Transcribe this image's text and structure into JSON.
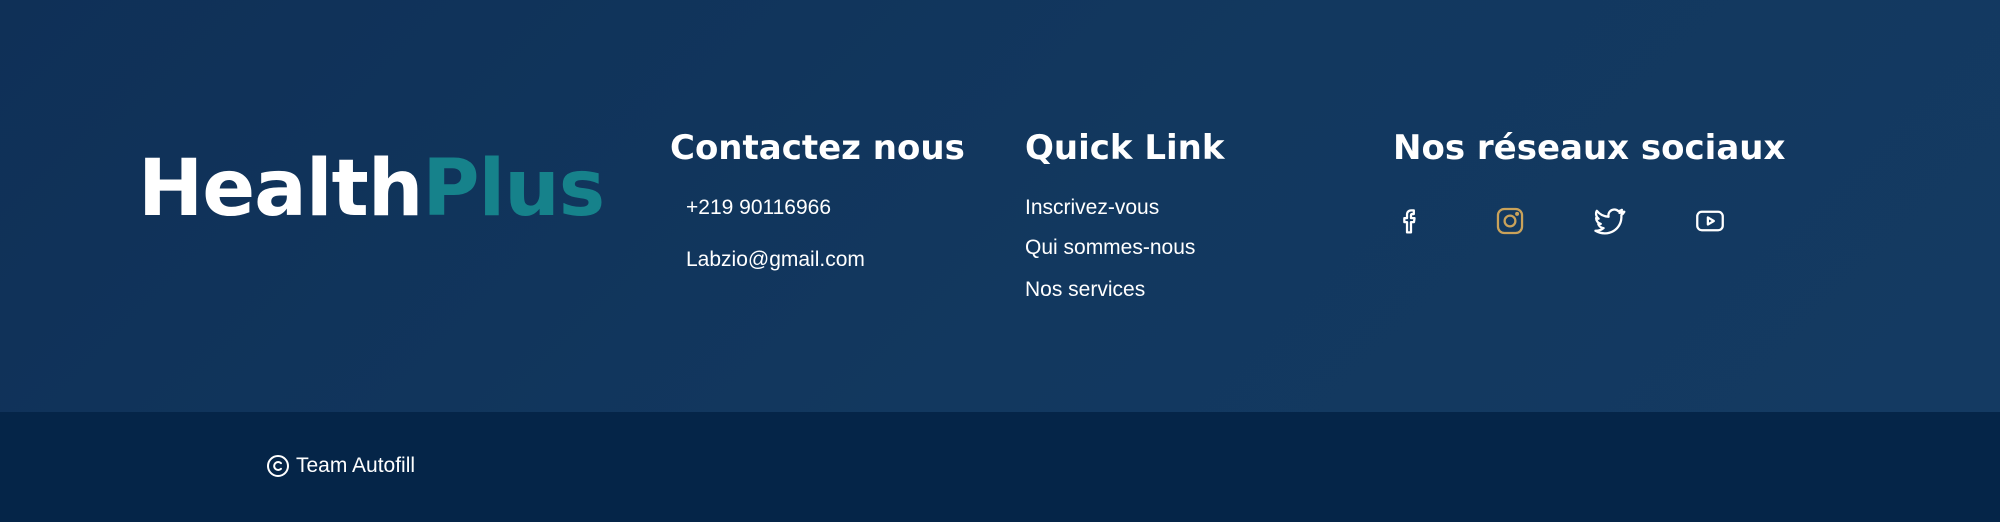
{
  "brand": {
    "part1": "Health",
    "part2": "Plus",
    "colors": {
      "primary": "#ffffff",
      "accent": "#16828b"
    }
  },
  "contact": {
    "title": "Contactez nous",
    "phone": "+219 90116966",
    "email": "Labzio@gmail.com"
  },
  "quick_links": {
    "title": "Quick Link",
    "items": [
      {
        "label": "Inscrivez-vous"
      },
      {
        "label": "Qui sommes-nous"
      },
      {
        "label": "Nos services"
      }
    ]
  },
  "social": {
    "title": "Nos réseaux sociaux",
    "icons": [
      {
        "name": "facebook-icon",
        "color": "#ffffff"
      },
      {
        "name": "instagram-icon",
        "color": "#c9a25a"
      },
      {
        "name": "twitter-icon",
        "color": "#ffffff"
      },
      {
        "name": "youtube-icon",
        "color": "#ffffff"
      }
    ]
  },
  "footer_bottom": {
    "copyright_icon": "copyright-icon",
    "copyright_text": "Team Autofill"
  },
  "colors": {
    "footer_bg": "#12385f",
    "footer_bottom_bg": "#052548"
  }
}
